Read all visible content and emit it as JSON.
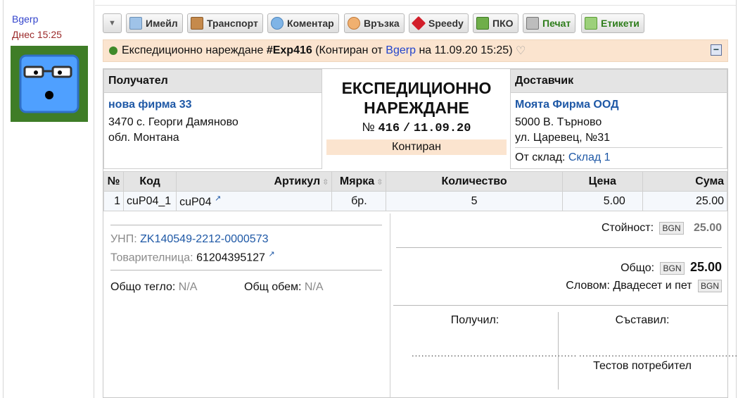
{
  "sidebar": {
    "author": "Bgerp",
    "date": "Днес 15:25"
  },
  "toolbar": {
    "buttons": [
      {
        "label": "",
        "icon": "chevron-down-icon"
      },
      {
        "label": "Имейл",
        "icon": "email-icon"
      },
      {
        "label": "Транспорт",
        "icon": "truck-icon"
      },
      {
        "label": "Коментар",
        "icon": "comment-icon"
      },
      {
        "label": "Връзка",
        "icon": "link-icon"
      },
      {
        "label": "Speedy",
        "icon": "box-icon"
      },
      {
        "label": "ПКО",
        "icon": "cash-icon"
      },
      {
        "label": "Печат",
        "icon": "print-icon"
      },
      {
        "label": "Етикети",
        "icon": "label-icon"
      }
    ]
  },
  "header": {
    "prefix": "Експедиционно нареждане",
    "number": "#Exp416",
    "status_open": "(Контиран от",
    "user": "Bgerp",
    "on": "на 11.09.20 15:25)",
    "heart": "♡"
  },
  "recipient": {
    "title": "Получател",
    "name": "нова фирма 33",
    "address1": "3470 с. Георги Дамяново",
    "address2": "обл. Монтана"
  },
  "document": {
    "title_line1": "ЕКСПЕДИЦИОННО",
    "title_line2": "НАРЕЖДАНЕ",
    "no_label": "№",
    "number": "416",
    "slash": "/",
    "date": "11.09.20",
    "status": "Контиран"
  },
  "supplier": {
    "title": "Доставчик",
    "name": "Моята Фирма ООД",
    "address1": "5000 В. Търново",
    "address2": "ул. Царевец, №31",
    "store_label": "От склад:",
    "store": "Склад 1"
  },
  "table": {
    "headers": [
      "№",
      "Код",
      "Артикул",
      "Мярка",
      "Количество",
      "Цена",
      "Сума"
    ],
    "rows": [
      {
        "n": "1",
        "code": "cuP04_1",
        "article": "cuP04",
        "ext": "↗",
        "unit": "бр.",
        "qty": "5",
        "price": "5.00",
        "sum": "25.00"
      }
    ]
  },
  "shipping": {
    "unp_label": "УНП:",
    "unp": "ZK140549-2212-0000573",
    "waybill_label": "Товарителница:",
    "waybill": "61204395127",
    "ext": "↗",
    "weight_label": "Общо тегло:",
    "weight": "N/A",
    "volume_label": "Общ обем:",
    "volume": "N/A"
  },
  "totals": {
    "value_label": "Стойност:",
    "currency": "BGN",
    "value": "25.00",
    "total_label": "Общо:",
    "total": "25.00",
    "words_label": "Словом: Двадесет и пет",
    "words_currency": "BGN"
  },
  "signatures": {
    "received_label": "Получил:",
    "composed_label": "Съставил:",
    "dots": "...................................................",
    "composer": "Тестов потребител"
  }
}
